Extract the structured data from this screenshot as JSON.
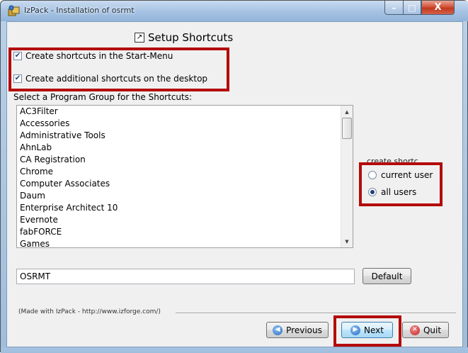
{
  "window": {
    "title": "IzPack - Installation of  osrmt",
    "minimize_glyph": "–",
    "maximize_glyph": "□",
    "close_glyph": "X"
  },
  "header": {
    "title": "Setup Shortcuts",
    "icon": "shortcut-icon"
  },
  "options": {
    "start_menu_label": "Create shortcuts in the Start-Menu",
    "start_menu_checked": true,
    "desktop_label": "Create additional shortcuts on the desktop",
    "desktop_checked": true
  },
  "program_group": {
    "label": "Select a Program Group for the Shortcuts:",
    "items": [
      "AC3Filter",
      "Accessories",
      "Administrative Tools",
      "AhnLab",
      "CA Registration",
      "Chrome",
      "Computer Associates",
      "Daum",
      "Enterprise Architect 10",
      "Evernote",
      "fabFORCE",
      "Games"
    ],
    "scroll_up": "▲",
    "scroll_down": "▼",
    "value": "OSRMT",
    "default_button": "Default"
  },
  "create_for": {
    "legend": "create shortc...",
    "options": [
      {
        "label": "current user",
        "selected": false
      },
      {
        "label": "all users",
        "selected": true
      }
    ]
  },
  "footer": {
    "made_with": "(Made with IzPack - http://www.izforge.com/)",
    "previous": "Previous",
    "next": "Next",
    "quit": "Quit"
  },
  "colors": {
    "highlight": "#b40a0a",
    "accent": "#2a6cc4"
  }
}
